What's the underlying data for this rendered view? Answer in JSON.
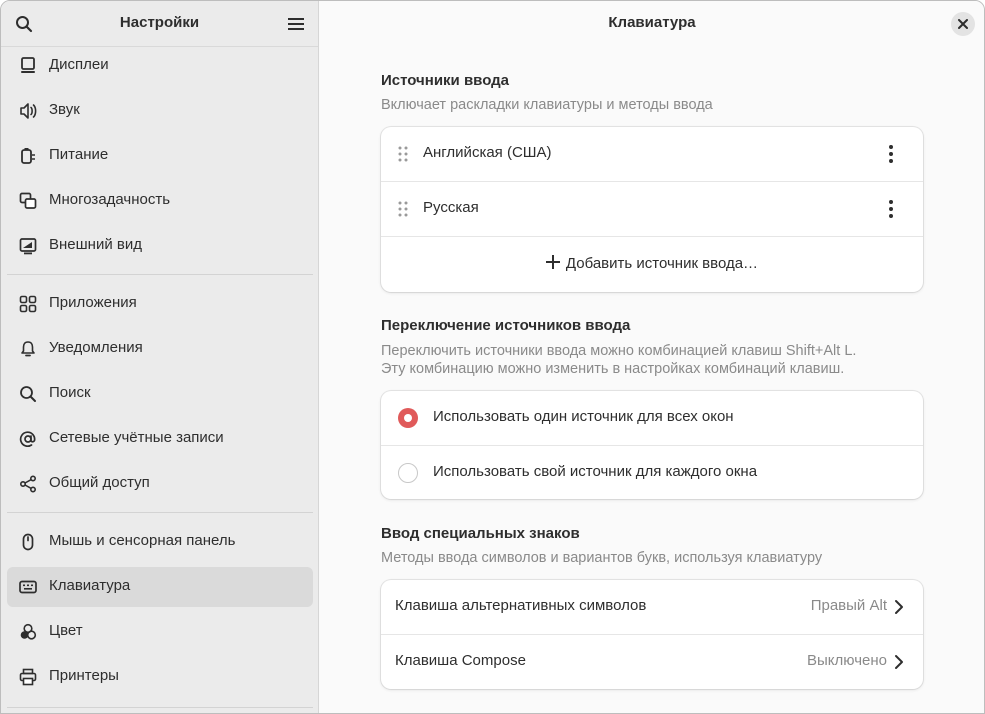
{
  "sidebar": {
    "title": "Настройки",
    "items": [
      {
        "label": "Дисплеи",
        "icon": "display-icon"
      },
      {
        "label": "Звук",
        "icon": "speaker-icon"
      },
      {
        "label": "Питание",
        "icon": "power-icon"
      },
      {
        "label": "Многозадачность",
        "icon": "multitasking-icon"
      },
      {
        "label": "Внешний вид",
        "icon": "appearance-icon"
      },
      {
        "label": "Приложения",
        "icon": "apps-grid-icon"
      },
      {
        "label": "Уведомления",
        "icon": "bell-icon"
      },
      {
        "label": "Поиск",
        "icon": "search-icon"
      },
      {
        "label": "Сетевые учётные записи",
        "icon": "at-icon"
      },
      {
        "label": "Общий доступ",
        "icon": "share-icon"
      },
      {
        "label": "Мышь и сенсорная панель",
        "icon": "mouse-icon"
      },
      {
        "label": "Клавиатура",
        "icon": "keyboard-icon"
      },
      {
        "label": "Цвет",
        "icon": "color-icon"
      },
      {
        "label": "Принтеры",
        "icon": "printer-icon"
      }
    ]
  },
  "main": {
    "title": "Клавиатура",
    "input_sources": {
      "title": "Источники ввода",
      "subtitle": "Включает раскладки клавиатуры и методы ввода",
      "sources": [
        "Английская (США)",
        "Русская"
      ],
      "add_label": "Добавить источник ввода…"
    },
    "switching": {
      "title": "Переключение источников ввода",
      "subtitle_line1": "Переключить источники ввода можно комбинацией клавиш Shift+Alt L.",
      "subtitle_line2": "Эту комбинацию можно изменить в настройках комбинаций клавиш.",
      "options": [
        {
          "label": "Использовать один источник для всех окон",
          "selected": true
        },
        {
          "label": "Использовать свой источник для каждого окна",
          "selected": false
        }
      ]
    },
    "special": {
      "title": "Ввод специальных знаков",
      "subtitle": "Методы ввода символов и вариантов букв, используя клавиатуру",
      "rows": [
        {
          "label": "Клавиша альтернативных символов",
          "value": "Правый Alt"
        },
        {
          "label": "Клавиша Compose",
          "value": "Выключено"
        }
      ]
    }
  },
  "colors": {
    "accent": "#e05a5a",
    "sidebar_bg": "#ebebeb",
    "active_bg": "#dadada"
  }
}
